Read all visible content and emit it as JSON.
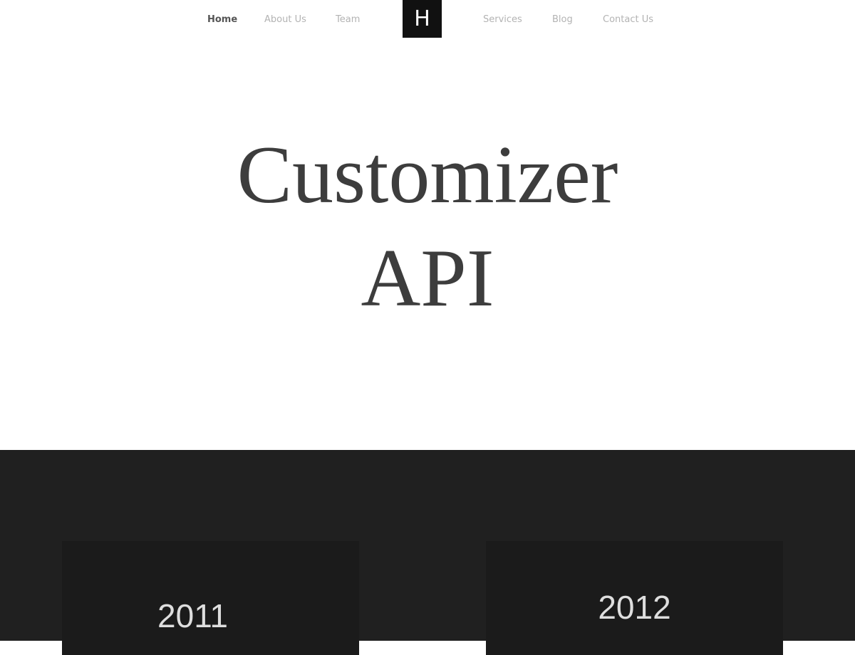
{
  "nav": {
    "items": [
      {
        "label": "Home",
        "active": true
      },
      {
        "label": "About Us",
        "active": false
      },
      {
        "label": "Team",
        "active": false
      },
      {
        "label": "Services",
        "active": false
      },
      {
        "label": "Blog",
        "active": false
      },
      {
        "label": "Contact Us",
        "active": false
      }
    ],
    "logo_letter": "H"
  },
  "hero": {
    "title_line1": "Customizer",
    "title_line2": "API"
  },
  "timeline": {
    "years": [
      "2011",
      "2012"
    ]
  },
  "colors": {
    "nav_active": "#555555",
    "nav_inactive": "#b3b3b3",
    "logo_bg": "#111111",
    "hero_text": "#3d3d3d",
    "dark_section": "#202020",
    "card_bg": "#1b1b1b"
  }
}
